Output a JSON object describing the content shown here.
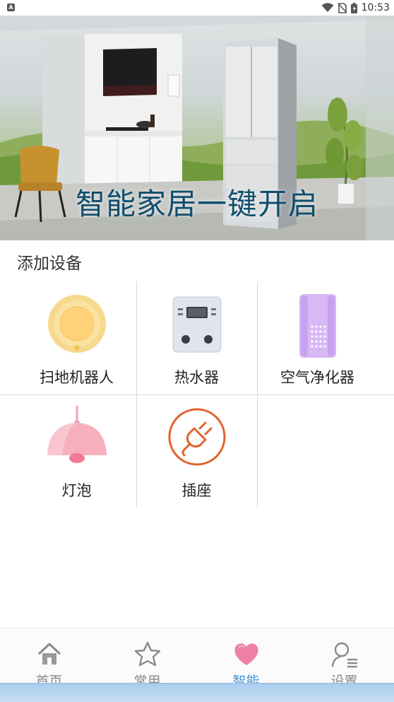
{
  "status_bar": {
    "time": "10:53",
    "app_icon": "A"
  },
  "banner": {
    "text": "智能家居一键开启"
  },
  "section": {
    "title": "添加设备"
  },
  "devices": [
    {
      "label": "扫地机器人",
      "icon": "robot-vacuum-icon"
    },
    {
      "label": "热水器",
      "icon": "water-heater-icon"
    },
    {
      "label": "空气净化器",
      "icon": "air-purifier-icon"
    },
    {
      "label": "灯泡",
      "icon": "pendant-lamp-icon"
    },
    {
      "label": "插座",
      "icon": "power-plug-icon"
    }
  ],
  "tabs": [
    {
      "label": "首页",
      "icon": "home-icon",
      "active": false
    },
    {
      "label": "常用",
      "icon": "star-icon",
      "active": false
    },
    {
      "label": "智能",
      "icon": "heart-icon",
      "active": true
    },
    {
      "label": "设置",
      "icon": "user-settings-icon",
      "active": false
    }
  ],
  "colors": {
    "accent": "#3b8fd6",
    "banner_text": "#0f4e6e",
    "tab_inactive": "#888888",
    "divider": "#d8d8d8",
    "plug_orange": "#e2622b"
  }
}
